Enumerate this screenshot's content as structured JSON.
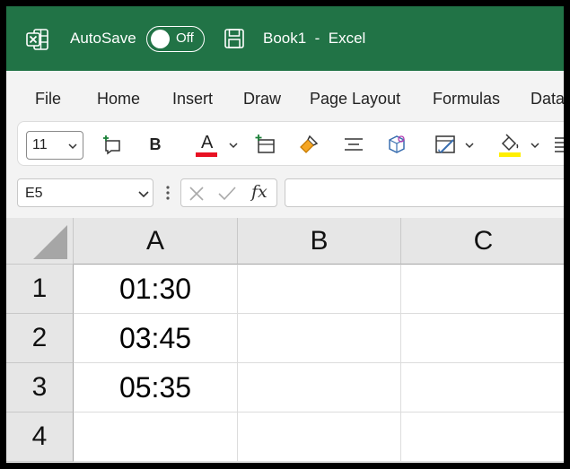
{
  "titlebar": {
    "autosave_label": "AutoSave",
    "autosave_state": "Off",
    "doc_title": "Book1  -  Excel",
    "bg_color": "#217346"
  },
  "menu": {
    "tabs": [
      "File",
      "Home",
      "Insert",
      "Draw",
      "Page Layout",
      "Formulas",
      "Data"
    ]
  },
  "ribbon": {
    "font_size": "11",
    "bold_label": "B",
    "font_color_label": "A",
    "font_color": "#e81123",
    "highlight_color": "#ffef00",
    "icons": [
      "new-comment-icon",
      "bold-icon",
      "font-color-icon",
      "insert-cells-icon",
      "format-painter-icon",
      "align-center-icon",
      "3d-shape-icon",
      "format-table-icon",
      "fill-color-icon",
      "align-icon"
    ]
  },
  "formula_bar": {
    "name_box": "E5",
    "fx_label": "fx",
    "formula_value": ""
  },
  "grid": {
    "columns": [
      "A",
      "B",
      "C"
    ],
    "rows": [
      "1",
      "2",
      "3",
      "4"
    ],
    "cells": [
      [
        "01:30",
        "",
        ""
      ],
      [
        "03:45",
        "",
        ""
      ],
      [
        "05:35",
        "",
        ""
      ],
      [
        "",
        "",
        ""
      ]
    ]
  }
}
